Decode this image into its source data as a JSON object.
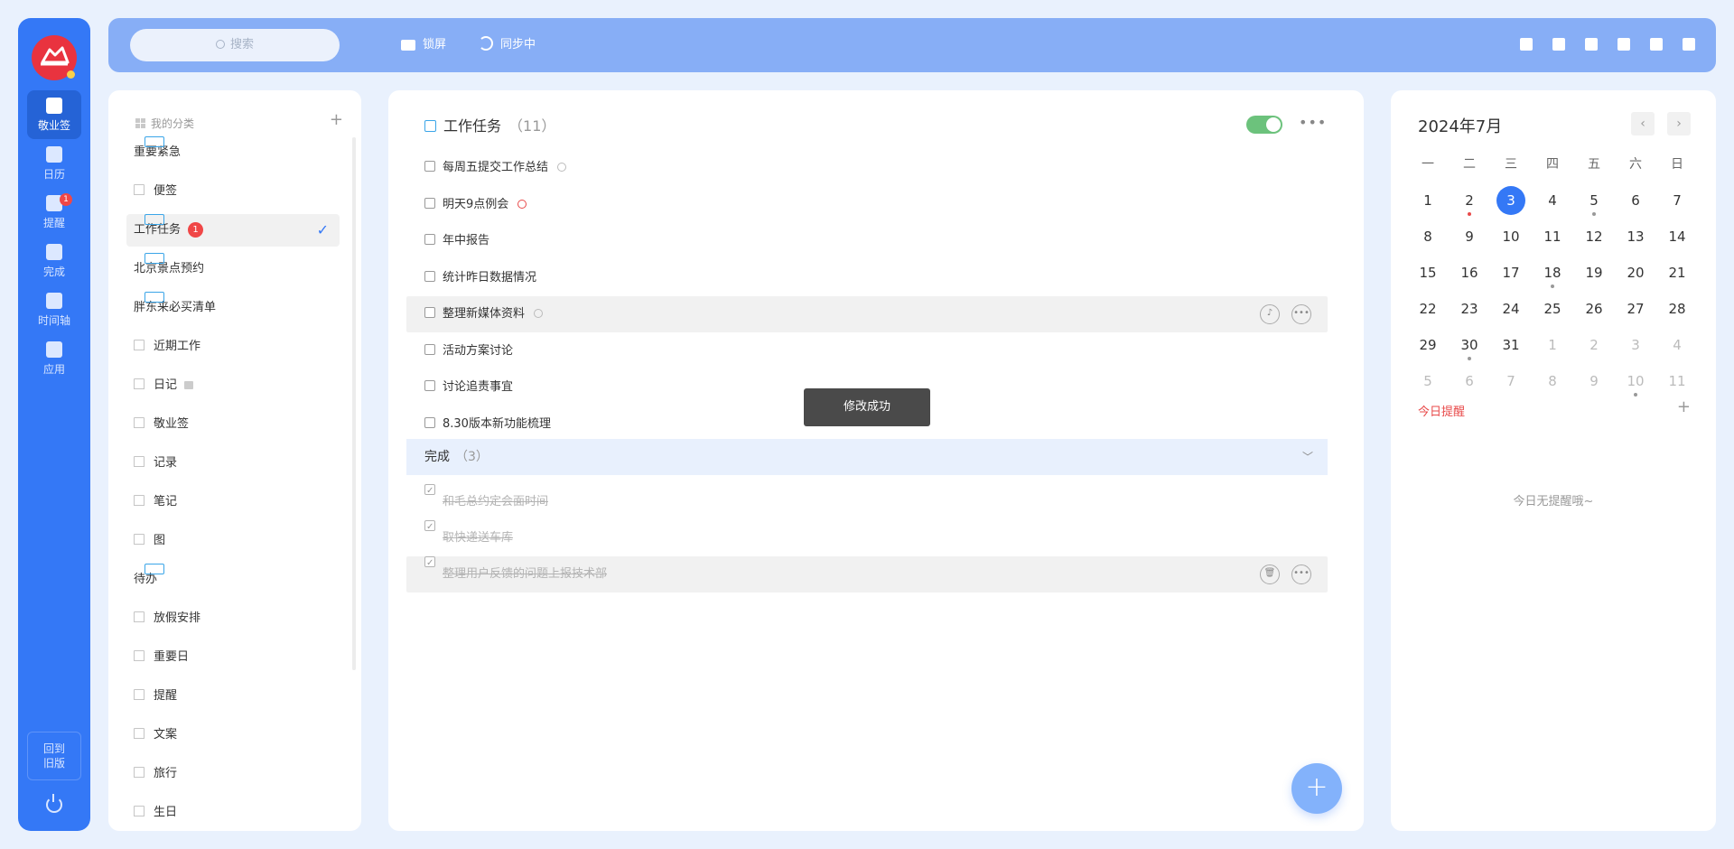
{
  "nav": {
    "items": [
      {
        "label": "敬业签",
        "icon": "cloud-note-icon",
        "active": true
      },
      {
        "label": "日历",
        "icon": "calendar-icon"
      },
      {
        "label": "提醒",
        "icon": "bell-icon",
        "badge": "1"
      },
      {
        "label": "完成",
        "icon": "done-clipboard-icon"
      },
      {
        "label": "时间轴",
        "icon": "timeline-icon"
      },
      {
        "label": "应用",
        "icon": "apps-cube-icon"
      }
    ],
    "back_line1": "回到",
    "back_line2": "旧版"
  },
  "topbar": {
    "search_placeholder": "搜索",
    "lock_label": "锁屏",
    "sync_label": "同步中",
    "platforms": [
      "desktop-icon",
      "tablet-icon",
      "apple-icon",
      "android-icon",
      "ie-browser-icon",
      "windows-icon"
    ]
  },
  "categories": {
    "header": "我的分类",
    "add": "+",
    "items": [
      {
        "label": "重要紧急",
        "type": "task"
      },
      {
        "label": "便签",
        "type": "note"
      },
      {
        "label": "工作任务",
        "type": "task",
        "badge": "1",
        "selected": true
      },
      {
        "label": "北京景点预约",
        "type": "task"
      },
      {
        "label": "胖东来必买清单",
        "type": "task"
      },
      {
        "label": "近期工作",
        "type": "note"
      },
      {
        "label": "日记",
        "type": "note",
        "locked": true
      },
      {
        "label": "敬业签",
        "type": "note"
      },
      {
        "label": "记录",
        "type": "note"
      },
      {
        "label": "笔记",
        "type": "note"
      },
      {
        "label": "图",
        "type": "note"
      },
      {
        "label": "待办",
        "type": "task"
      },
      {
        "label": "放假安排",
        "type": "note"
      },
      {
        "label": "重要日",
        "type": "note"
      },
      {
        "label": "提醒",
        "type": "note"
      },
      {
        "label": "文案",
        "type": "note"
      },
      {
        "label": "旅行",
        "type": "note"
      },
      {
        "label": "生日",
        "type": "note"
      }
    ]
  },
  "tasks": {
    "title": "工作任务",
    "count": "（11）",
    "open": [
      {
        "label": "每周五提交工作总结",
        "clock": "grey"
      },
      {
        "label": "明天9点例会",
        "clock": "red"
      },
      {
        "label": "年中报告"
      },
      {
        "label": "统计昨日数据情况"
      },
      {
        "label": "整理新媒体资料",
        "clock": "grey",
        "highlight": true
      },
      {
        "label": "活动方案讨论"
      },
      {
        "label": "讨论追责事宜"
      },
      {
        "label": "8.30版本新功能梳理"
      }
    ],
    "done_label": "完成",
    "done_count": "（3）",
    "done": [
      {
        "label": "和毛总约定会面时间"
      },
      {
        "label": "取快递送车库"
      },
      {
        "label": "整理用户反馈的问题上报技术部",
        "highlight": true
      }
    ],
    "toast": "修改成功",
    "fab": "+"
  },
  "calendar": {
    "month": "2024年7月",
    "weekdays": [
      "一",
      "二",
      "三",
      "四",
      "五",
      "六",
      "日"
    ],
    "weeks": [
      [
        {
          "d": "1"
        },
        {
          "d": "2",
          "mark": "red"
        },
        {
          "d": "3",
          "today": true
        },
        {
          "d": "4"
        },
        {
          "d": "5",
          "mark": "grey"
        },
        {
          "d": "6"
        },
        {
          "d": "7"
        }
      ],
      [
        {
          "d": "8"
        },
        {
          "d": "9"
        },
        {
          "d": "10"
        },
        {
          "d": "11"
        },
        {
          "d": "12"
        },
        {
          "d": "13"
        },
        {
          "d": "14"
        }
      ],
      [
        {
          "d": "15"
        },
        {
          "d": "16"
        },
        {
          "d": "17"
        },
        {
          "d": "18",
          "mark": "grey"
        },
        {
          "d": "19"
        },
        {
          "d": "20"
        },
        {
          "d": "21"
        }
      ],
      [
        {
          "d": "22"
        },
        {
          "d": "23"
        },
        {
          "d": "24"
        },
        {
          "d": "25"
        },
        {
          "d": "26"
        },
        {
          "d": "27"
        },
        {
          "d": "28"
        }
      ],
      [
        {
          "d": "29"
        },
        {
          "d": "30",
          "mark": "grey"
        },
        {
          "d": "31"
        },
        {
          "d": "1",
          "muted": true
        },
        {
          "d": "2",
          "muted": true
        },
        {
          "d": "3",
          "muted": true
        },
        {
          "d": "4",
          "muted": true
        }
      ],
      [
        {
          "d": "5",
          "muted": true
        },
        {
          "d": "6",
          "muted": true
        },
        {
          "d": "7",
          "muted": true
        },
        {
          "d": "8",
          "muted": true
        },
        {
          "d": "9",
          "muted": true
        },
        {
          "d": "10",
          "muted": true,
          "mark": "grey"
        },
        {
          "d": "11",
          "muted": true
        }
      ]
    ],
    "remind_title": "今日提醒",
    "remind_add": "+",
    "remind_empty": "今日无提醒哦~"
  },
  "colors": {
    "accent": "#3478f6",
    "nav_bg": "#3478f6",
    "topbar_bg": "#87aef6",
    "page_bg": "#e9f1fd",
    "toggle_on": "#6cc27c",
    "danger": "#e84a4a"
  }
}
